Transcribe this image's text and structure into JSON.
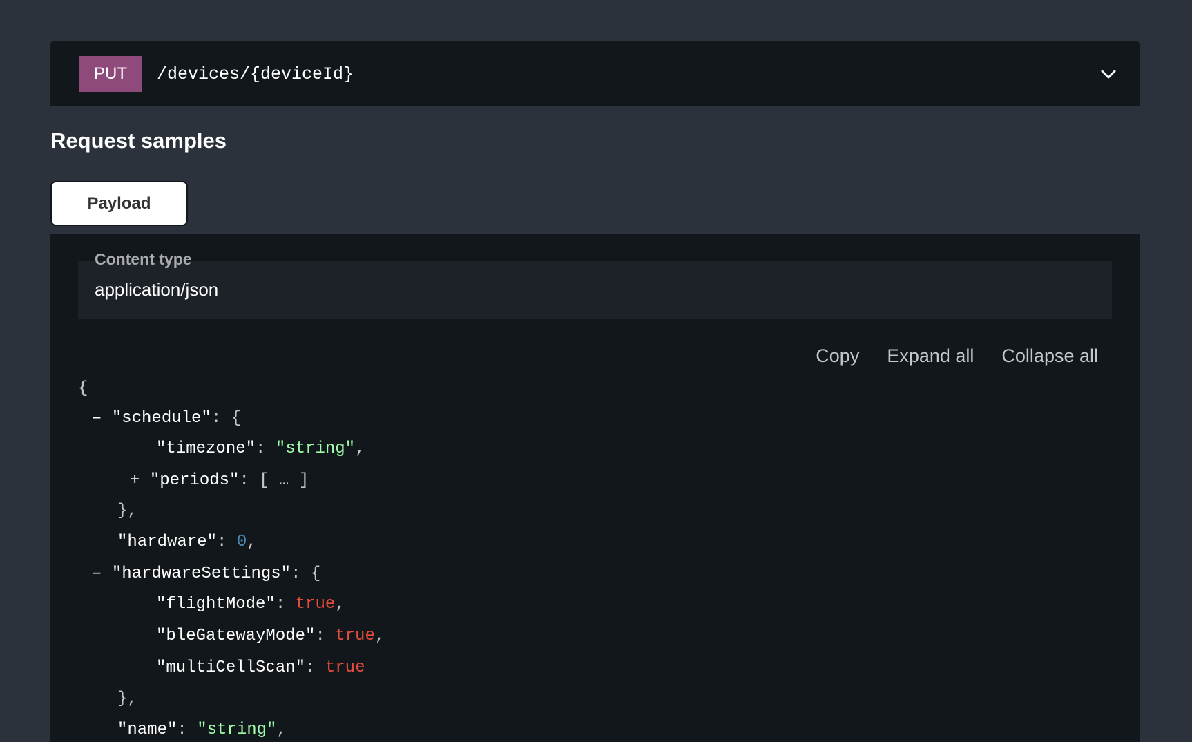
{
  "endpoint": {
    "method": "PUT",
    "path": "/devices/{deviceId}",
    "chevron_icon": "chevron-down-icon"
  },
  "section": {
    "title": "Request samples"
  },
  "tabs": [
    {
      "label": "Payload",
      "active": true
    }
  ],
  "content_type": {
    "label": "Content type",
    "value": "application/json"
  },
  "actions": {
    "copy": "Copy",
    "expand_all": "Expand all",
    "collapse_all": "Collapse all"
  },
  "code": {
    "open_brace": "{",
    "collapse_symbol": "–",
    "expand_symbol": "+",
    "schedule_key": "\"schedule\"",
    "timezone_key": "\"timezone\"",
    "timezone_value": "\"string\"",
    "periods_key": "\"periods\"",
    "periods_value": "[ … ]",
    "hardware_key": "\"hardware\"",
    "hardware_value": "0",
    "hardware_settings_key": "\"hardwareSettings\"",
    "flight_mode_key": "\"flightMode\"",
    "flight_mode_value": "true",
    "ble_gateway_mode_key": "\"bleGatewayMode\"",
    "ble_gateway_mode_value": "true",
    "multi_cell_scan_key": "\"multiCellScan\"",
    "multi_cell_scan_value": "true",
    "name_key": "\"name\"",
    "name_value": "\"string\""
  },
  "colors": {
    "page_bg": "#2b323b",
    "panel_bg": "#11171a",
    "method_put": "#8e4a7a",
    "string": "#a0fbaa",
    "number": "#4a8bb3",
    "boolean": "#e64b3c"
  }
}
